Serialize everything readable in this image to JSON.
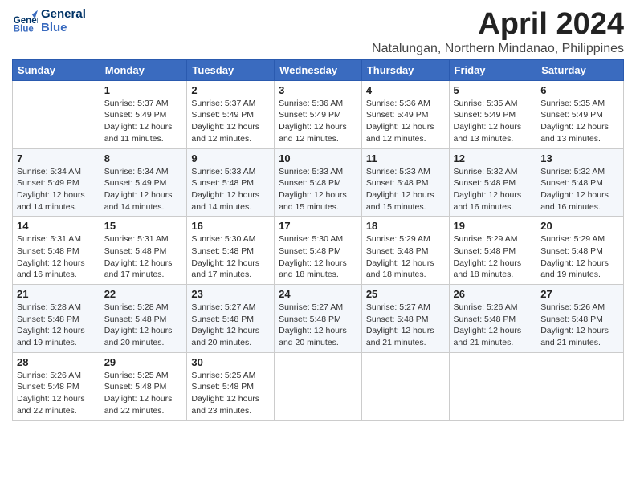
{
  "header": {
    "logo_line1": "General",
    "logo_line2": "Blue",
    "month_title": "April 2024",
    "location": "Natalungan, Northern Mindanao, Philippines"
  },
  "days_of_week": [
    "Sunday",
    "Monday",
    "Tuesday",
    "Wednesday",
    "Thursday",
    "Friday",
    "Saturday"
  ],
  "weeks": [
    [
      {
        "day": "",
        "sunrise": "",
        "sunset": "",
        "daylight": ""
      },
      {
        "day": "1",
        "sunrise": "Sunrise: 5:37 AM",
        "sunset": "Sunset: 5:49 PM",
        "daylight": "Daylight: 12 hours and 11 minutes."
      },
      {
        "day": "2",
        "sunrise": "Sunrise: 5:37 AM",
        "sunset": "Sunset: 5:49 PM",
        "daylight": "Daylight: 12 hours and 12 minutes."
      },
      {
        "day": "3",
        "sunrise": "Sunrise: 5:36 AM",
        "sunset": "Sunset: 5:49 PM",
        "daylight": "Daylight: 12 hours and 12 minutes."
      },
      {
        "day": "4",
        "sunrise": "Sunrise: 5:36 AM",
        "sunset": "Sunset: 5:49 PM",
        "daylight": "Daylight: 12 hours and 12 minutes."
      },
      {
        "day": "5",
        "sunrise": "Sunrise: 5:35 AM",
        "sunset": "Sunset: 5:49 PM",
        "daylight": "Daylight: 12 hours and 13 minutes."
      },
      {
        "day": "6",
        "sunrise": "Sunrise: 5:35 AM",
        "sunset": "Sunset: 5:49 PM",
        "daylight": "Daylight: 12 hours and 13 minutes."
      }
    ],
    [
      {
        "day": "7",
        "sunrise": "Sunrise: 5:34 AM",
        "sunset": "Sunset: 5:49 PM",
        "daylight": "Daylight: 12 hours and 14 minutes."
      },
      {
        "day": "8",
        "sunrise": "Sunrise: 5:34 AM",
        "sunset": "Sunset: 5:49 PM",
        "daylight": "Daylight: 12 hours and 14 minutes."
      },
      {
        "day": "9",
        "sunrise": "Sunrise: 5:33 AM",
        "sunset": "Sunset: 5:48 PM",
        "daylight": "Daylight: 12 hours and 14 minutes."
      },
      {
        "day": "10",
        "sunrise": "Sunrise: 5:33 AM",
        "sunset": "Sunset: 5:48 PM",
        "daylight": "Daylight: 12 hours and 15 minutes."
      },
      {
        "day": "11",
        "sunrise": "Sunrise: 5:33 AM",
        "sunset": "Sunset: 5:48 PM",
        "daylight": "Daylight: 12 hours and 15 minutes."
      },
      {
        "day": "12",
        "sunrise": "Sunrise: 5:32 AM",
        "sunset": "Sunset: 5:48 PM",
        "daylight": "Daylight: 12 hours and 16 minutes."
      },
      {
        "day": "13",
        "sunrise": "Sunrise: 5:32 AM",
        "sunset": "Sunset: 5:48 PM",
        "daylight": "Daylight: 12 hours and 16 minutes."
      }
    ],
    [
      {
        "day": "14",
        "sunrise": "Sunrise: 5:31 AM",
        "sunset": "Sunset: 5:48 PM",
        "daylight": "Daylight: 12 hours and 16 minutes."
      },
      {
        "day": "15",
        "sunrise": "Sunrise: 5:31 AM",
        "sunset": "Sunset: 5:48 PM",
        "daylight": "Daylight: 12 hours and 17 minutes."
      },
      {
        "day": "16",
        "sunrise": "Sunrise: 5:30 AM",
        "sunset": "Sunset: 5:48 PM",
        "daylight": "Daylight: 12 hours and 17 minutes."
      },
      {
        "day": "17",
        "sunrise": "Sunrise: 5:30 AM",
        "sunset": "Sunset: 5:48 PM",
        "daylight": "Daylight: 12 hours and 18 minutes."
      },
      {
        "day": "18",
        "sunrise": "Sunrise: 5:29 AM",
        "sunset": "Sunset: 5:48 PM",
        "daylight": "Daylight: 12 hours and 18 minutes."
      },
      {
        "day": "19",
        "sunrise": "Sunrise: 5:29 AM",
        "sunset": "Sunset: 5:48 PM",
        "daylight": "Daylight: 12 hours and 18 minutes."
      },
      {
        "day": "20",
        "sunrise": "Sunrise: 5:29 AM",
        "sunset": "Sunset: 5:48 PM",
        "daylight": "Daylight: 12 hours and 19 minutes."
      }
    ],
    [
      {
        "day": "21",
        "sunrise": "Sunrise: 5:28 AM",
        "sunset": "Sunset: 5:48 PM",
        "daylight": "Daylight: 12 hours and 19 minutes."
      },
      {
        "day": "22",
        "sunrise": "Sunrise: 5:28 AM",
        "sunset": "Sunset: 5:48 PM",
        "daylight": "Daylight: 12 hours and 20 minutes."
      },
      {
        "day": "23",
        "sunrise": "Sunrise: 5:27 AM",
        "sunset": "Sunset: 5:48 PM",
        "daylight": "Daylight: 12 hours and 20 minutes."
      },
      {
        "day": "24",
        "sunrise": "Sunrise: 5:27 AM",
        "sunset": "Sunset: 5:48 PM",
        "daylight": "Daylight: 12 hours and 20 minutes."
      },
      {
        "day": "25",
        "sunrise": "Sunrise: 5:27 AM",
        "sunset": "Sunset: 5:48 PM",
        "daylight": "Daylight: 12 hours and 21 minutes."
      },
      {
        "day": "26",
        "sunrise": "Sunrise: 5:26 AM",
        "sunset": "Sunset: 5:48 PM",
        "daylight": "Daylight: 12 hours and 21 minutes."
      },
      {
        "day": "27",
        "sunrise": "Sunrise: 5:26 AM",
        "sunset": "Sunset: 5:48 PM",
        "daylight": "Daylight: 12 hours and 21 minutes."
      }
    ],
    [
      {
        "day": "28",
        "sunrise": "Sunrise: 5:26 AM",
        "sunset": "Sunset: 5:48 PM",
        "daylight": "Daylight: 12 hours and 22 minutes."
      },
      {
        "day": "29",
        "sunrise": "Sunrise: 5:25 AM",
        "sunset": "Sunset: 5:48 PM",
        "daylight": "Daylight: 12 hours and 22 minutes."
      },
      {
        "day": "30",
        "sunrise": "Sunrise: 5:25 AM",
        "sunset": "Sunset: 5:48 PM",
        "daylight": "Daylight: 12 hours and 23 minutes."
      },
      {
        "day": "",
        "sunrise": "",
        "sunset": "",
        "daylight": ""
      },
      {
        "day": "",
        "sunrise": "",
        "sunset": "",
        "daylight": ""
      },
      {
        "day": "",
        "sunrise": "",
        "sunset": "",
        "daylight": ""
      },
      {
        "day": "",
        "sunrise": "",
        "sunset": "",
        "daylight": ""
      }
    ]
  ]
}
